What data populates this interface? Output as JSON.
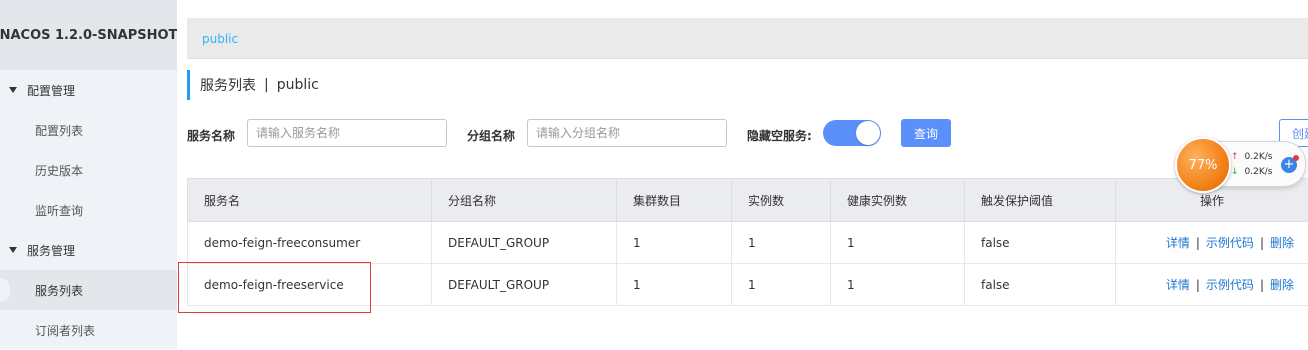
{
  "app": {
    "logo": "NACOS 1.2.0-SNAPSHOT"
  },
  "sidebar": {
    "groups": [
      {
        "label": "配置管理",
        "items": [
          "配置列表",
          "历史版本",
          "监听查询"
        ]
      },
      {
        "label": "服务管理",
        "items": [
          "服务列表",
          "订阅者列表"
        ]
      }
    ],
    "active_item": "服务列表"
  },
  "namespace_tab": "public",
  "page": {
    "title": "服务列表",
    "separator": "|",
    "namespace": "public"
  },
  "filters": {
    "service_name_label": "服务名称",
    "service_name_placeholder": "请输入服务名称",
    "group_name_label": "分组名称",
    "group_name_placeholder": "请输入分组名称",
    "hide_empty_label": "隐藏空服务:",
    "hide_empty_on": true,
    "query_button": "查询",
    "create_button": "创建服务"
  },
  "table": {
    "headers": [
      "服务名",
      "分组名称",
      "集群数目",
      "实例数",
      "健康实例数",
      "触发保护阈值",
      "操作"
    ],
    "rows": [
      {
        "name": "demo-feign-freeconsumer",
        "group": "DEFAULT_GROUP",
        "clusters": "1",
        "instances": "1",
        "healthy": "1",
        "threshold": "false"
      },
      {
        "name": "demo-feign-freeservice",
        "group": "DEFAULT_GROUP",
        "clusters": "1",
        "instances": "1",
        "healthy": "1",
        "threshold": "false"
      }
    ],
    "actions": {
      "detail": "详情",
      "sample_code": "示例代码",
      "delete": "删除",
      "sep": "|"
    }
  },
  "net_widget": {
    "percent": "77%",
    "up": "0.2K/s",
    "down": "0.2K/s",
    "up_arrow": "↑",
    "down_arrow": "↓",
    "plus": "+"
  },
  "colors": {
    "accent": "#5b8ff9",
    "link": "#2077d1",
    "tab": "#2eb3ff",
    "highlight": "#e03c3c"
  }
}
